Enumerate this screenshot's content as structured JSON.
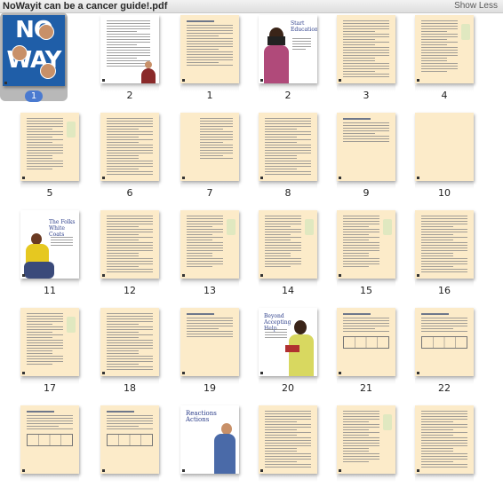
{
  "window": {
    "title": "NoWayit can be a cancer guide!.pdf",
    "toggle_label": "Show Less"
  },
  "cover": {
    "big_top": "NO",
    "big_bottom": "WAY"
  },
  "page_texts": {
    "start_title": "Start Education",
    "folks_title": "The Folks White Coats",
    "help_title": "Beyond Accepting Help",
    "reactions_title": "Reactions Actions"
  },
  "thumbnails": [
    {
      "label": "1",
      "kind": "cover",
      "selected": true
    },
    {
      "label": "2",
      "kind": "text-photo"
    },
    {
      "label": "1",
      "kind": "toc"
    },
    {
      "label": "2",
      "kind": "photo-girl-book"
    },
    {
      "label": "3",
      "kind": "text"
    },
    {
      "label": "4",
      "kind": "text-side"
    },
    {
      "label": "5",
      "kind": "text-side"
    },
    {
      "label": "6",
      "kind": "text"
    },
    {
      "label": "7",
      "kind": "text-margin"
    },
    {
      "label": "8",
      "kind": "text"
    },
    {
      "label": "9",
      "kind": "text-short"
    },
    {
      "label": "10",
      "kind": "blank"
    },
    {
      "label": "11",
      "kind": "photo-boy"
    },
    {
      "label": "12",
      "kind": "text"
    },
    {
      "label": "13",
      "kind": "text-side"
    },
    {
      "label": "14",
      "kind": "text-side"
    },
    {
      "label": "15",
      "kind": "text-side"
    },
    {
      "label": "16",
      "kind": "text"
    },
    {
      "label": "17",
      "kind": "text-side"
    },
    {
      "label": "18",
      "kind": "text"
    },
    {
      "label": "19",
      "kind": "text-short"
    },
    {
      "label": "20",
      "kind": "photo-girl"
    },
    {
      "label": "21",
      "kind": "table"
    },
    {
      "label": "22",
      "kind": "table"
    },
    {
      "label": "",
      "kind": "table"
    },
    {
      "label": "",
      "kind": "table"
    },
    {
      "label": "",
      "kind": "photo-reactions"
    },
    {
      "label": "",
      "kind": "text"
    },
    {
      "label": "",
      "kind": "text-side"
    },
    {
      "label": "",
      "kind": "text"
    }
  ],
  "colors": {
    "cream_page": "#fcebc9",
    "cover_blue": "#1f5ea8",
    "selection_badge": "#4a7ad0"
  }
}
